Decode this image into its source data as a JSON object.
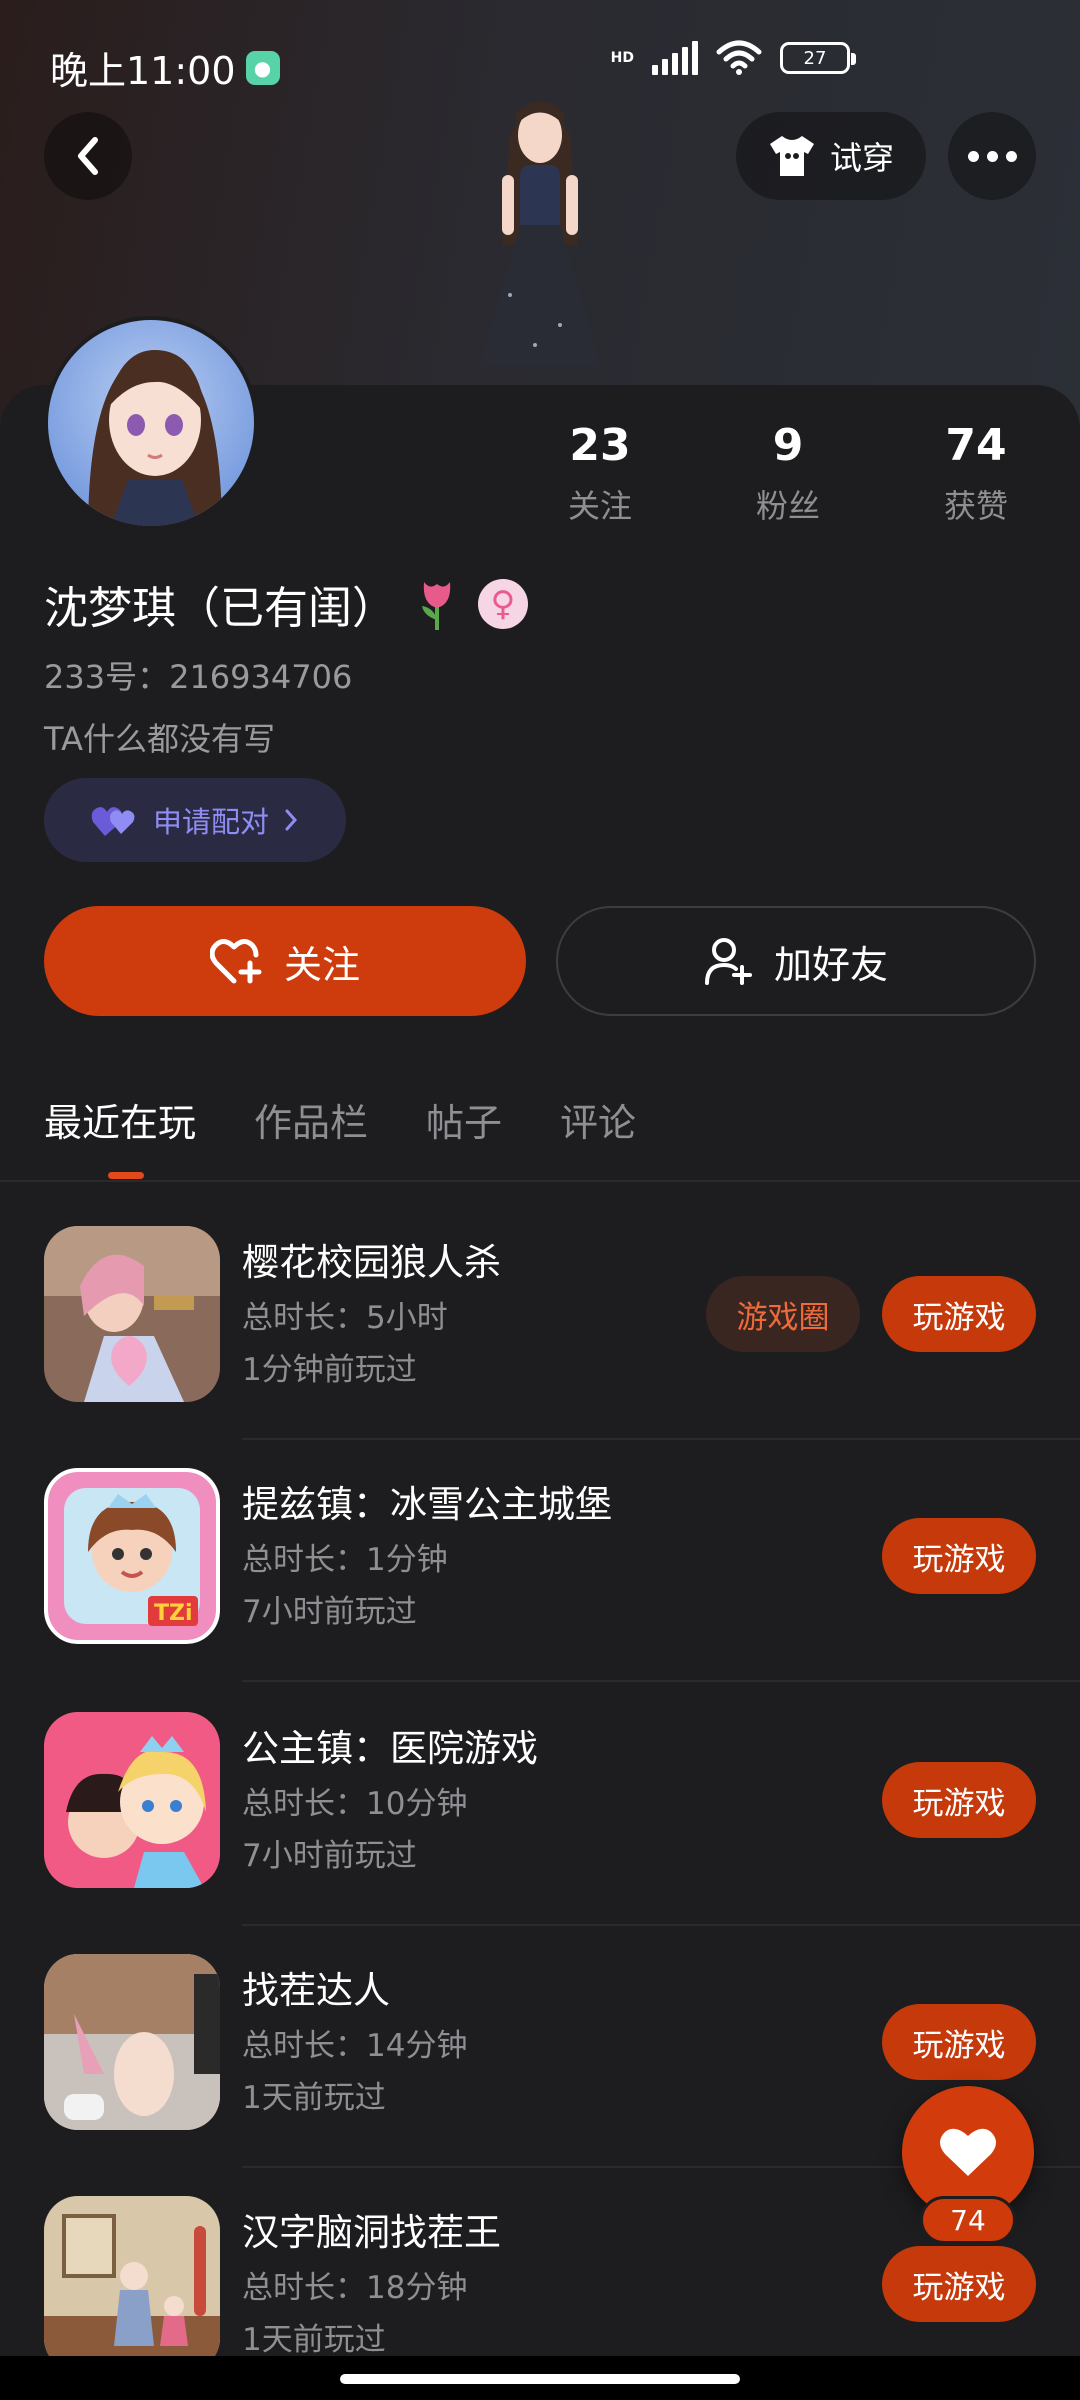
{
  "status_bar": {
    "time": "晚上11:00",
    "network": "HD",
    "battery": "27"
  },
  "header": {
    "tryon_label": "试穿"
  },
  "profile": {
    "name": "沈梦琪（已有闺）",
    "uid": "233号：216934706",
    "bio": "TA什么都没有写",
    "pair_label": "申请配对",
    "stats": [
      {
        "num": "23",
        "label": "关注"
      },
      {
        "num": "9",
        "label": "粉丝"
      },
      {
        "num": "74",
        "label": "获赞"
      }
    ]
  },
  "actions": {
    "follow_label": "关注",
    "add_friend_label": "加好友"
  },
  "tabs": [
    "最近在玩",
    "作品栏",
    "帖子",
    "评论"
  ],
  "games": [
    {
      "title": "樱花校园狼人杀",
      "duration": "总时长：5小时",
      "ago": "1分钟前玩过",
      "circle_label": "游戏圈",
      "play_label": "玩游戏"
    },
    {
      "title": "提兹镇：冰雪公主城堡",
      "duration": "总时长：1分钟",
      "ago": "7小时前玩过",
      "play_label": "玩游戏"
    },
    {
      "title": "公主镇：医院游戏",
      "duration": "总时长：10分钟",
      "ago": "7小时前玩过",
      "play_label": "玩游戏"
    },
    {
      "title": "找茬达人",
      "duration": "总时长：14分钟",
      "ago": "1天前玩过",
      "play_label": "玩游戏"
    },
    {
      "title": "汉字脑洞找茬王",
      "duration": "总时长：18分钟",
      "ago": "1天前玩过",
      "play_label": "玩游戏"
    }
  ],
  "like": {
    "count": "74"
  },
  "colors": {
    "accent": "#ce3b0c",
    "pair": "#8f8cf3",
    "background": "#1d1d1f"
  }
}
